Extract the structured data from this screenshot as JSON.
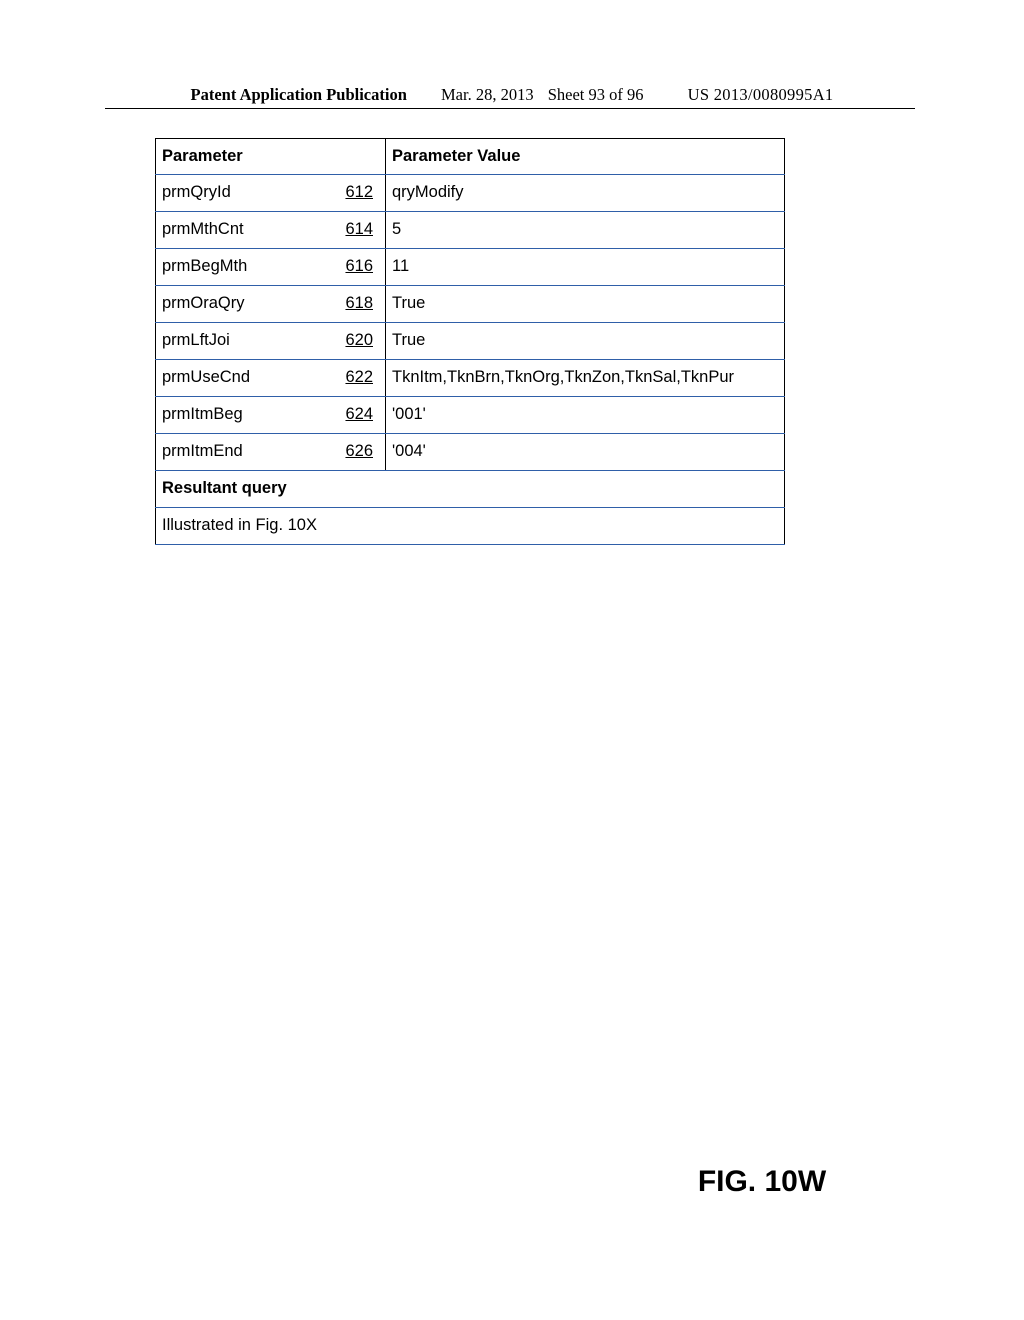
{
  "header": {
    "publication": "Patent Application Publication",
    "date": "Mar. 28, 2013",
    "sheet": "Sheet 93 of 96",
    "appnum": "US 2013/0080995A1"
  },
  "table": {
    "col1": "Parameter",
    "col2": "Parameter Value",
    "rows": [
      {
        "name": "prmQryId",
        "ref": "612",
        "value": "qryModify"
      },
      {
        "name": "prmMthCnt",
        "ref": "614",
        "value": "5"
      },
      {
        "name": "prmBegMth",
        "ref": "616",
        "value": "11"
      },
      {
        "name": "prmOraQry",
        "ref": "618",
        "value": "True"
      },
      {
        "name": "prmLftJoi",
        "ref": "620",
        "value": "True"
      },
      {
        "name": "prmUseCnd",
        "ref": "622",
        "value": "TknItm,TknBrn,TknOrg,TknZon,TknSal,TknPur"
      },
      {
        "name": "prmItmBeg",
        "ref": "624",
        "value": "'001'"
      },
      {
        "name": "prmItmEnd",
        "ref": "626",
        "value": "'004'"
      }
    ],
    "resultant_label": "Resultant query",
    "illustrated": "Illustrated in Fig. 10X"
  },
  "figure_label": "FIG. 10W"
}
